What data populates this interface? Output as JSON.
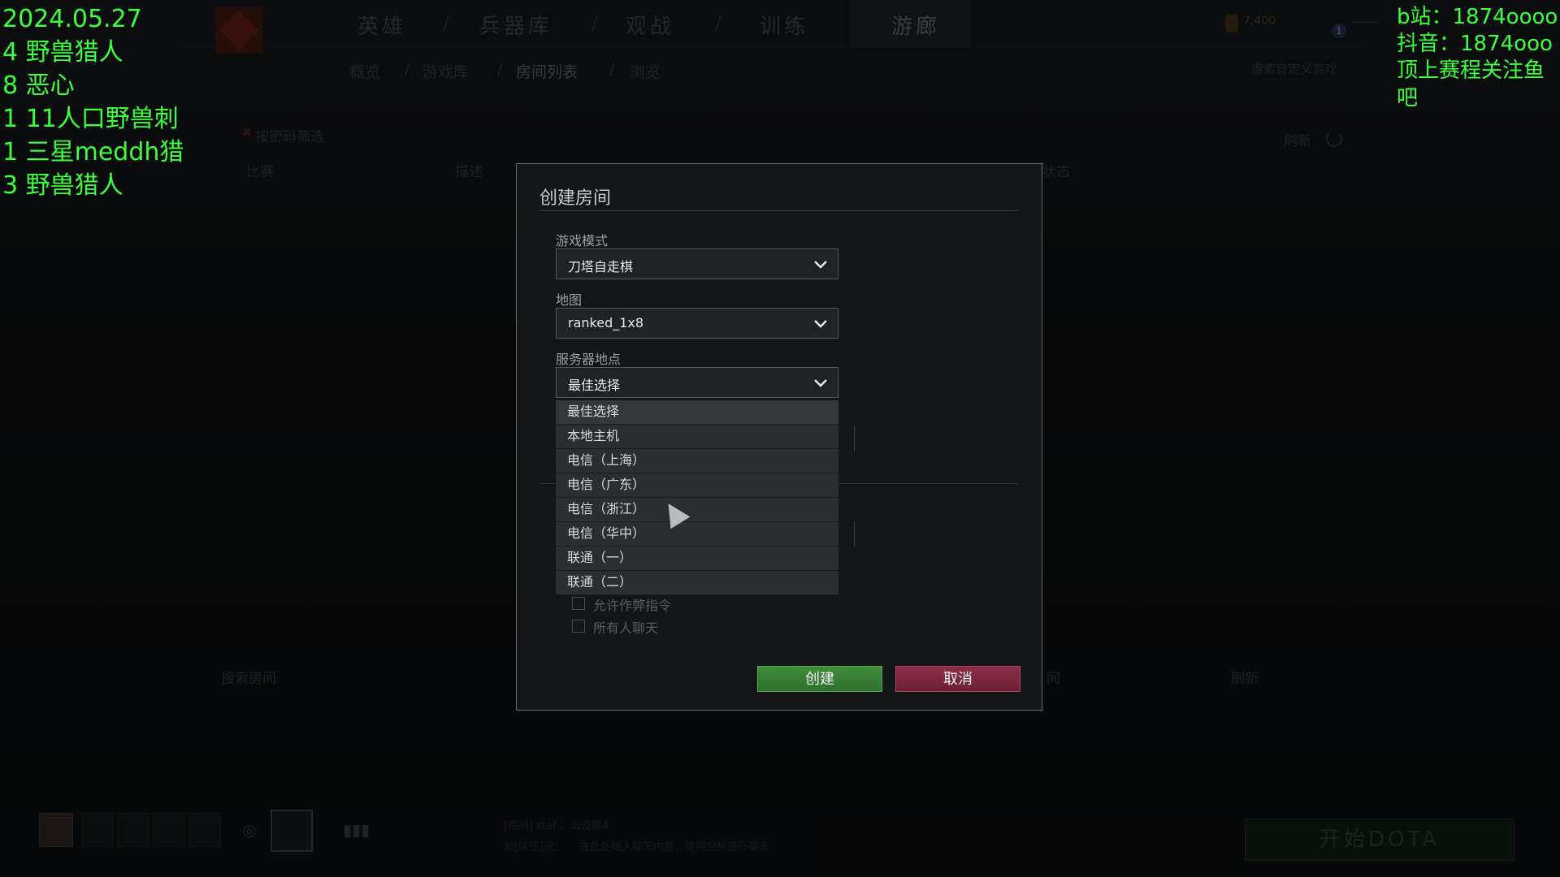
{
  "overlay": {
    "left_lines": [
      "2024.05.27",
      "4 野兽猎人",
      "8 恶心",
      "1 11人口野兽刺",
      "1 三星meddh猎",
      "3 野兽猎人"
    ],
    "right_lines": [
      "b站：1874oooo",
      "抖音：1874ooo",
      "顶上赛程关注鱼吧"
    ]
  },
  "nav": {
    "tabs": [
      "英雄",
      "兵器库",
      "观战",
      "训练",
      "游廊"
    ],
    "active_tab": "游廊",
    "breadcrumb": [
      "概览",
      "游戏库",
      "房间列表",
      "浏览"
    ],
    "gold": "7,400",
    "notification_count": "1",
    "search_placeholder": "搜索自定义游戏"
  },
  "background": {
    "filter_label": "按密码筛选",
    "refresh_label": "刷新",
    "col_game": "比赛",
    "col_desc": "描述",
    "col_status": "状态",
    "bottom_search": "搜索房间",
    "room_suffix": "间",
    "room_list_button": "刷新",
    "chat_line1": "[房间] stef ：么没建4",
    "chat_line2": "对[队伍]说：",
    "chat_placeholder": "在此处输入聊天内容，使用空格进行聊天",
    "start_button": "开始DOTA"
  },
  "dialog": {
    "title": "创建房间",
    "game_mode_label": "游戏模式",
    "game_mode_value": "刀塔自走棋",
    "map_label": "地图",
    "map_value": "ranked_1x8",
    "server_label": "服务器地点",
    "server_value": "最佳选择",
    "server_options": [
      "最佳选择",
      "本地主机",
      "电信（上海）",
      "电信（广东）",
      "电信（浙江）",
      "电信（华中）",
      "联通（一）",
      "联通（二）"
    ],
    "checkboxes": [
      "允许作弊指令",
      "所有人聊天"
    ],
    "create_label": "创建",
    "cancel_label": "取消"
  }
}
